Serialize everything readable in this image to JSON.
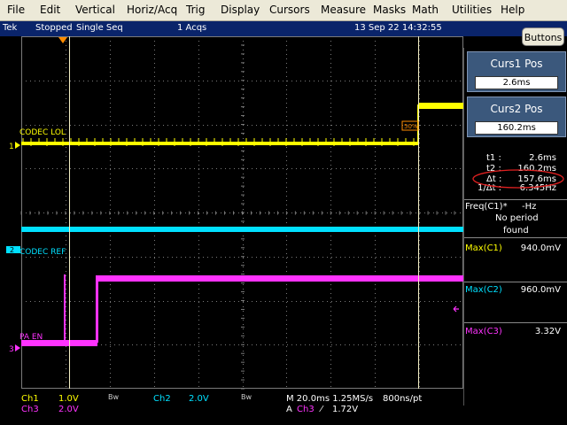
{
  "menu": [
    "File",
    "Edit",
    "Vertical",
    "Horiz/Acq",
    "Trig",
    "Display",
    "Cursors",
    "Measure",
    "Masks",
    "Math",
    "Utilities",
    "Help"
  ],
  "status": {
    "brand": "Tek",
    "run_state": "Stopped",
    "seq": "Single Seq",
    "acqs": "1 Acqs",
    "datetime": "13 Sep 22 14:32:55"
  },
  "buttons_label": "Buttons",
  "cursors": {
    "curs1": {
      "title": "Curs1 Pos",
      "value": "2.6ms"
    },
    "curs2": {
      "title": "Curs2 Pos",
      "value": "160.2ms"
    },
    "readout": [
      {
        "label": "t1 :",
        "value": "2.6ms"
      },
      {
        "label": "t2 :",
        "value": "160.2ms"
      },
      {
        "label": "Δt :",
        "value": "157.6ms"
      },
      {
        "label": "1/Δt :",
        "value": "6.345Hz"
      }
    ]
  },
  "measurements": {
    "freq_label": "Freq(C1)*",
    "freq_value": "-Hz",
    "freq_note_1": "No period",
    "freq_note_2": "found",
    "max_c1_label": "Max(C1)",
    "max_c1_value": "940.0mV",
    "max_c2_label": "Max(C2)",
    "max_c2_value": "960.0mV",
    "max_c3_label": "Max(C3)",
    "max_c3_value": "3.32V"
  },
  "traces": {
    "ch1_label": "CODEC LOL",
    "ch1_marker": "1",
    "ch2_label": "CODEC REF",
    "ch2_marker": "2",
    "ch3_label": "PA EN",
    "ch3_marker": "3",
    "trigger_level_tag": "50%"
  },
  "bottom": {
    "ch1": "Ch1",
    "ch1_scale": "1.0V",
    "ch1_bw": "Bw",
    "ch2": "Ch2",
    "ch2_scale": "2.0V",
    "ch2_bw": "Bw",
    "ch3": "Ch3",
    "ch3_scale": "2.0V",
    "timebase": "M 20.0ms 1.25MS/s",
    "resolution": "800ns/pt",
    "trig_prefix": "A",
    "trig_source": "Ch3",
    "trig_slope": "⁄",
    "trig_level": "1.72V"
  },
  "colors": {
    "ch1": "#ffff00",
    "ch2": "#00e0ff",
    "ch3": "#ff33ff",
    "grid": "#7a7a7a",
    "cursor": "#f4efc4",
    "panel": "#3b587c"
  }
}
